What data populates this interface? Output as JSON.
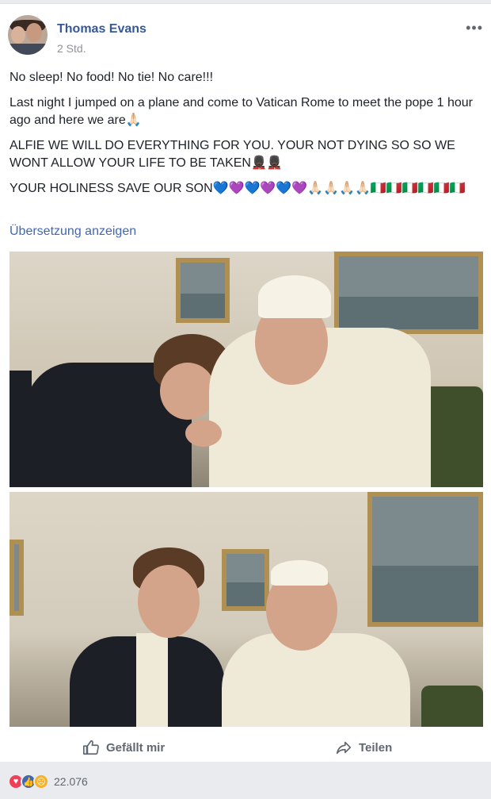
{
  "post": {
    "author": "Thomas Evans",
    "time": "2 Std.",
    "more_label": "•••",
    "lines": [
      "No sleep! No food! No tie! No care!!!",
      "Last night I jumped on a plane and come to Vatican Rome to meet the pope 1 hour ago and here we are🙏🏻",
      "ALFIE WE WILL DO EVERYTHING FOR YOU. YOUR NOT DYING SO SO WE WONT ALLOW YOUR LIFE TO BE TAKEN💂🏿💂🏿",
      "YOUR HOLINESS SAVE OUR SON💙💜💙💜💙💜🙏🏻🙏🏻🙏🏻🙏🏻🇮🇹🇮🇹🇮🇹🇮🇹🇮🇹🇮🇹"
    ],
    "translate_link": "Übersetzung anzeigen"
  },
  "actions": {
    "like_label": "Gefällt mir",
    "share_label": "Teilen"
  },
  "reactions": {
    "count": "22.076",
    "types": [
      "love",
      "like",
      "sad"
    ]
  },
  "icons": {
    "like": "thumbs-up-icon",
    "share": "share-arrow-icon",
    "more": "more-options-icon"
  },
  "colors": {
    "link": "#365899",
    "muted": "#90949c",
    "love": "#f33e58",
    "like": "#4267b2",
    "sad": "#f7b125"
  }
}
